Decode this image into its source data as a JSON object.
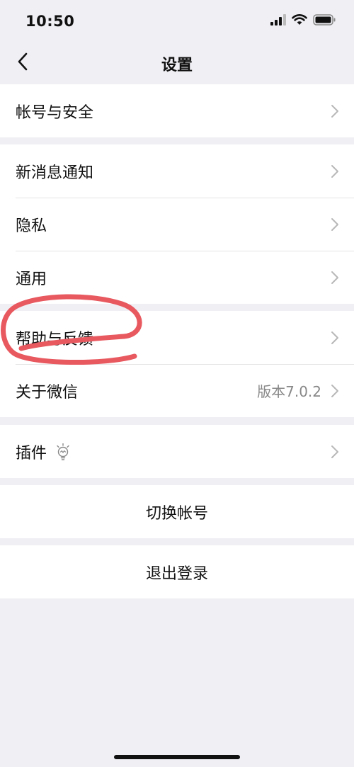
{
  "status_bar": {
    "time": "10:50",
    "icons": [
      "cellular-signal-icon",
      "wifi-icon",
      "battery-icon"
    ]
  },
  "nav": {
    "title": "设置",
    "back_icon": "chevron-left-icon"
  },
  "groups": [
    {
      "items": [
        {
          "label": "帐号与安全"
        }
      ]
    },
    {
      "items": [
        {
          "label": "新消息通知"
        },
        {
          "label": "隐私"
        },
        {
          "label": "通用"
        }
      ]
    },
    {
      "items": [
        {
          "label": "帮助与反馈"
        },
        {
          "label": "关于微信",
          "value": "版本7.0.2"
        }
      ]
    },
    {
      "items": [
        {
          "label": "插件",
          "icon": "lightbulb-icon"
        }
      ]
    }
  ],
  "actions": {
    "switch_account": "切换帐号",
    "logout": "退出登录"
  },
  "colors": {
    "background": "#efeff4",
    "annotation": "#e8585f",
    "chevron": "#b8b8b8",
    "secondary_text": "#888888"
  }
}
